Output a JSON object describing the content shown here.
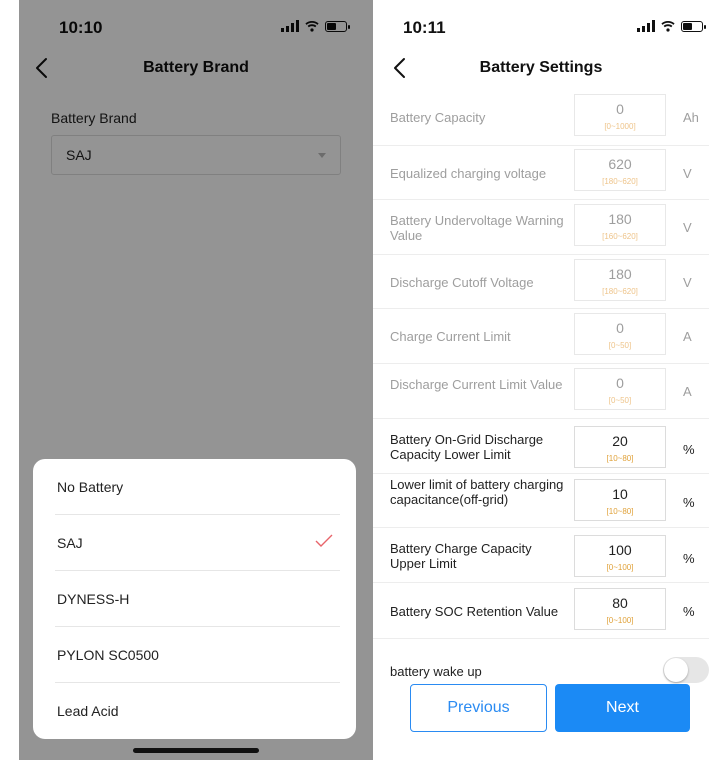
{
  "left": {
    "status": {
      "time": "10:10"
    },
    "nav": {
      "title": "Battery Brand"
    },
    "form": {
      "label": "Battery Brand",
      "value": "SAJ"
    },
    "options": [
      {
        "label": "No Battery",
        "selected": false
      },
      {
        "label": "SAJ",
        "selected": true
      },
      {
        "label": "DYNESS-H",
        "selected": false
      },
      {
        "label": "PYLON SC0500",
        "selected": false
      },
      {
        "label": "Lead Acid",
        "selected": false
      }
    ],
    "check_color": "#e8646a"
  },
  "right": {
    "status": {
      "time": "10:11"
    },
    "nav": {
      "title": "Battery Settings"
    },
    "settings": [
      {
        "label": "Battery Capacity",
        "value": "0",
        "range": "[0~1000]",
        "unit": "Ah",
        "enabled": false
      },
      {
        "label": "Equalized charging voltage",
        "value": "620",
        "range": "[180~620]",
        "unit": "V",
        "enabled": false
      },
      {
        "label": "Battery Undervoltage Warning Value",
        "value": "180",
        "range": "[160~620]",
        "unit": "V",
        "enabled": false
      },
      {
        "label": "Discharge Cutoff Voltage",
        "value": "180",
        "range": "[180~620]",
        "unit": "V",
        "enabled": false
      },
      {
        "label": "Charge Current Limit",
        "value": "0",
        "range": "[0~50]",
        "unit": "A",
        "enabled": false
      },
      {
        "label": "Discharge Current Limit Value",
        "value": "0",
        "range": "[0~50]",
        "unit": "A",
        "enabled": false
      },
      {
        "label": "Battery On-Grid Discharge Capacity Lower Limit",
        "value": "20",
        "range": "[10~80]",
        "unit": "%",
        "enabled": true
      },
      {
        "label": "Lower limit of battery charging capacitance(off-grid)",
        "value": "10",
        "range": "[10~80]",
        "unit": "%",
        "enabled": true
      },
      {
        "label": "Battery Charge Capacity Upper Limit",
        "value": "100",
        "range": "[0~100]",
        "unit": "%",
        "enabled": true
      },
      {
        "label": "Battery SOC Retention Value",
        "value": "80",
        "range": "[0~100]",
        "unit": "%",
        "enabled": true
      }
    ],
    "wake": {
      "label": "battery wake up",
      "on": false
    },
    "buttons": {
      "previous": "Previous",
      "next": "Next"
    },
    "accent": "#1b8af5"
  }
}
